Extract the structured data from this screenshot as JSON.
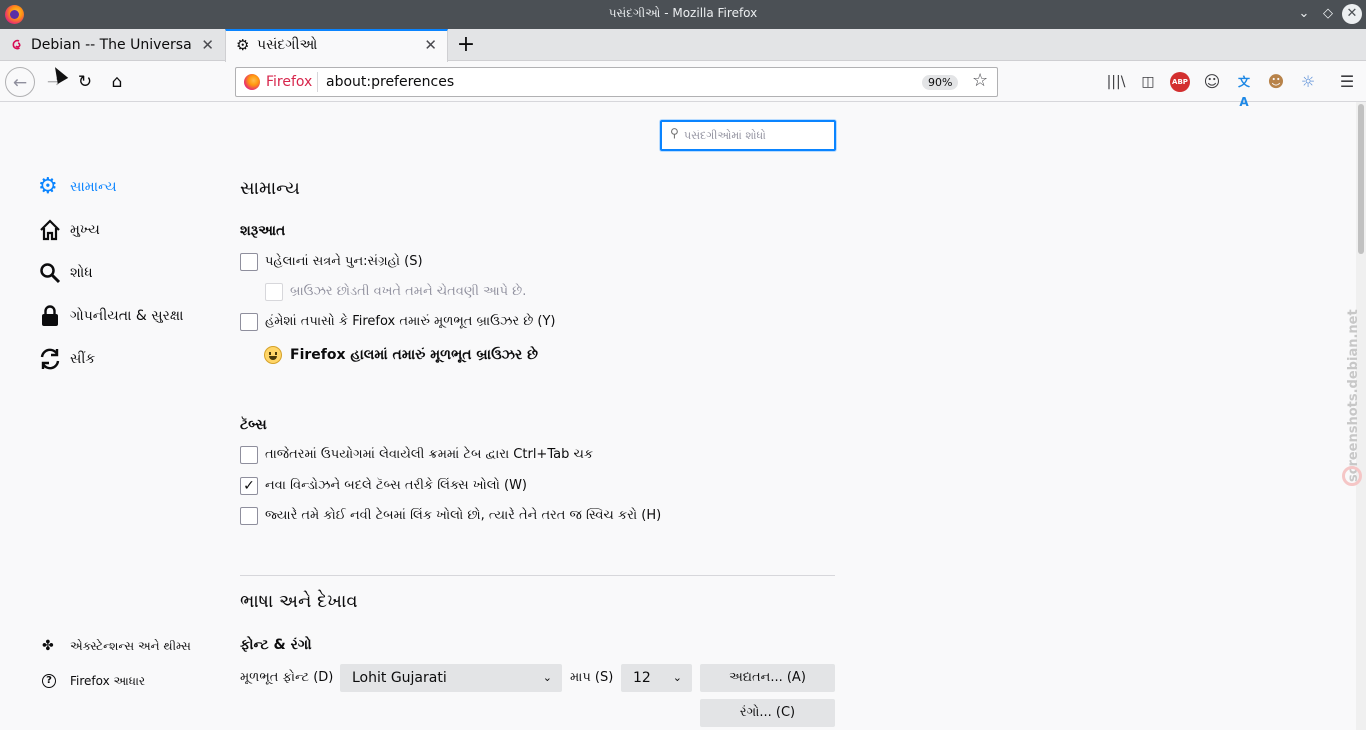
{
  "window": {
    "title": "પસંદગીઓ - Mozilla Firefox"
  },
  "tabs": [
    {
      "label": "Debian -- The Universal Operating System",
      "active": false
    },
    {
      "label": "પસંદગીઓ",
      "active": true
    }
  ],
  "tab_close_glyph": "✕",
  "new_tab_glyph": "+",
  "navbar": {
    "identity_label": "Firefox",
    "url": "about:preferences",
    "zoom": "90%"
  },
  "search": {
    "placeholder": "પસંદગીઓમાં શોધો"
  },
  "sidebar": {
    "items": [
      {
        "label": "સામાન્ય",
        "icon": "gear-icon",
        "active": true
      },
      {
        "label": "મુખ્ય",
        "icon": "home-icon",
        "active": false
      },
      {
        "label": "શોધ",
        "icon": "search-icon",
        "active": false
      },
      {
        "label": "ગોપનીયતા & સુરક્ષા",
        "icon": "lock-icon",
        "active": false
      },
      {
        "label": "સીંક",
        "icon": "sync-icon",
        "active": false
      }
    ],
    "footer": [
      {
        "label": "એક્સ્ટેન્શન્સ અને થીમ્સ",
        "icon": "puzzle-icon"
      },
      {
        "label": "Firefox આધાર",
        "icon": "help-icon"
      }
    ]
  },
  "general": {
    "heading": "સામાન્ય",
    "startup": {
      "heading": "શરૂઆત",
      "restore_session": {
        "label": "પહેલાનાં સત્રને પુન:સંગ્રહો (S)",
        "checked": false
      },
      "warn_quit": {
        "label": "બ્રાઉઝર છોડતી વખતે તમને ચેતવણી આપે છે.",
        "checked": false,
        "disabled": true
      },
      "check_default": {
        "label": "હંમેશાં તપાસો કે Firefox તમારું મૂળભૂત બ્રાઉઝર છે (Y)",
        "checked": false
      },
      "is_default_msg": "Firefox હાલમાં તમારું મૂળભૂત બ્રાઉઝર છે"
    },
    "tabs": {
      "heading": "ટૅબ્સ",
      "ctrl_tab": {
        "label": "તાજેતરમાં ઉપયોગમાં લેવાયેલી ક્રમમાં ટેબ દ્વારા Ctrl+Tab ચક",
        "checked": false
      },
      "open_links_tabs": {
        "label": "નવા વિન્ડોઝને બદલે ટૅબ્સ તરીકે લિંક્સ ખોલો (W)",
        "checked": true
      },
      "switch_to_tab": {
        "label": "જ્યારે તમે કોઈ નવી ટેબમાં લિંક ખોલો છો, ત્યારે તેને તરત જ સ્વિચ કરો (H)",
        "checked": false
      }
    }
  },
  "language": {
    "heading": "ભાષા અને દેખાવ",
    "fonts_heading": "ફોન્ટ & રંગો",
    "default_font_label": "મૂળભૂત ફોન્ટ (D)",
    "default_font_value": "Lohit Gujarati",
    "size_label": "માપ (S)",
    "size_value": "12",
    "advanced_button": "અદ્યતન... (A)",
    "colors_button": "રંગો... (C)"
  },
  "checkmark_glyph": "✓",
  "watermark": "screenshots.debian.net",
  "colors": {
    "accent": "#0a84ff",
    "titlebar": "#4b5055"
  }
}
